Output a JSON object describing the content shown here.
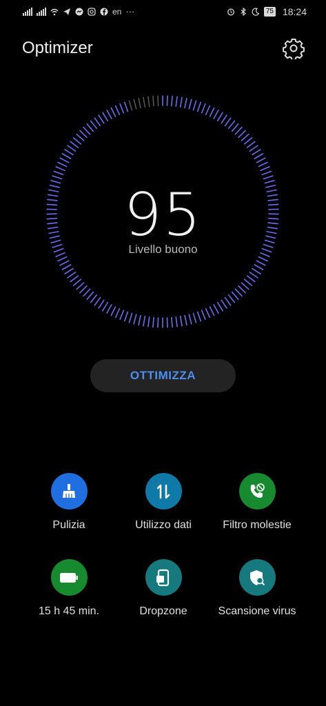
{
  "status_bar": {
    "language": "en",
    "more": "···",
    "battery_level": "75",
    "time": "18:24"
  },
  "header": {
    "title": "Optimizer"
  },
  "score": {
    "value": "95",
    "status_text": "Livello buono"
  },
  "optimize_button": {
    "label": "OTTIMIZZA"
  },
  "tools": [
    {
      "label": "Pulizia",
      "icon": "broom-icon",
      "color": "#1f6fe0"
    },
    {
      "label": "Utilizzo dati",
      "icon": "data-transfer-icon",
      "color": "#0f7aa7"
    },
    {
      "label": "Filtro molestie",
      "icon": "block-call-icon",
      "color": "#178a2f"
    },
    {
      "label": "15 h 45 min.",
      "icon": "battery-icon",
      "color": "#178a2f"
    },
    {
      "label": "Dropzone",
      "icon": "phone-drop-icon",
      "color": "#16797e"
    },
    {
      "label": "Scansione virus",
      "icon": "shield-scan-icon",
      "color": "#16797e"
    }
  ],
  "colors": {
    "background": "#000000",
    "accent": "#4d8ef2",
    "dial_tick": "#6c6ef2",
    "dial_tick_dim": "#555555"
  }
}
